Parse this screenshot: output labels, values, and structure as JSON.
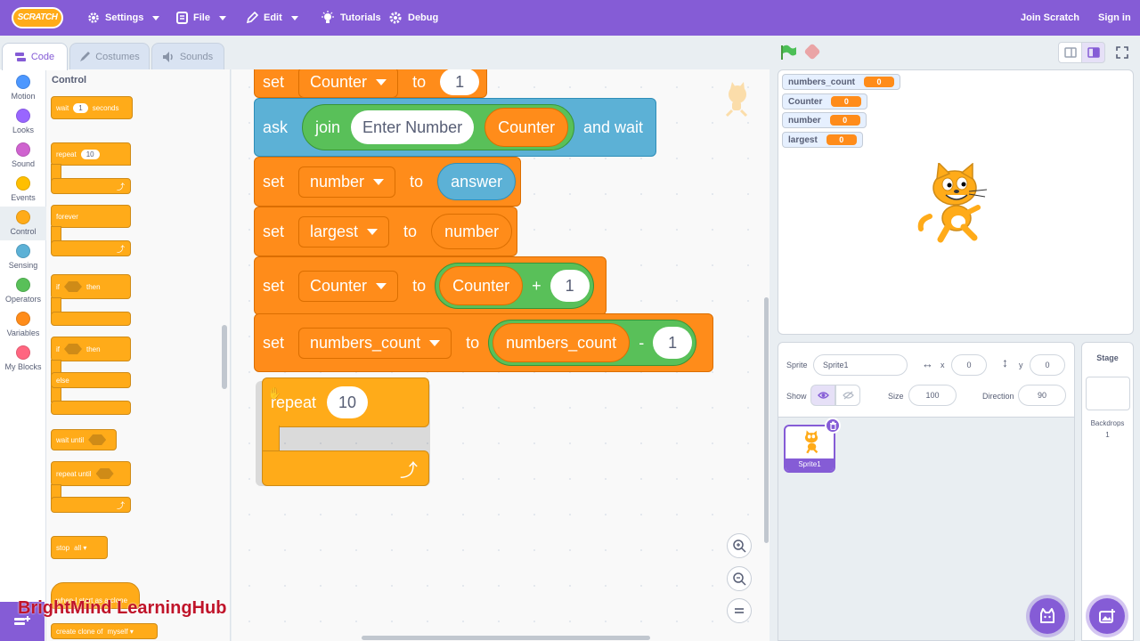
{
  "menubar": {
    "logo": "SCRATCH",
    "settings": "Settings",
    "file": "File",
    "edit": "Edit",
    "tutorials": "Tutorials",
    "debug": "Debug",
    "join": "Join Scratch",
    "signin": "Sign in",
    "color": "#855cd6"
  },
  "tabs": {
    "code": "Code",
    "costumes": "Costumes",
    "sounds": "Sounds"
  },
  "categories": [
    {
      "label": "Motion",
      "color": "#4c97ff"
    },
    {
      "label": "Looks",
      "color": "#9966ff"
    },
    {
      "label": "Sound",
      "color": "#cf63cf"
    },
    {
      "label": "Events",
      "color": "#ffbf00"
    },
    {
      "label": "Control",
      "color": "#ffab19"
    },
    {
      "label": "Sensing",
      "color": "#5cb1d6"
    },
    {
      "label": "Operators",
      "color": "#59c059"
    },
    {
      "label": "Variables",
      "color": "#ff8c1a"
    },
    {
      "label": "My Blocks",
      "color": "#ff6680"
    }
  ],
  "palette": {
    "title": "Control",
    "wait": "wait",
    "wait_val": "1",
    "seconds": "seconds",
    "repeat": "repeat",
    "repeat_val": "10",
    "forever": "forever",
    "if": "if",
    "then": "then",
    "if2": "if",
    "then2": "then",
    "else": "else",
    "wait_until": "wait until",
    "repeat_until": "repeat until",
    "stop": "stop",
    "stop_val": "all",
    "when_clone": "when I start as a clone",
    "create_clone": "create clone of",
    "create_clone_val": "myself"
  },
  "script": {
    "set1": {
      "word": "set",
      "var": "Counter",
      "to": "to",
      "val": "1"
    },
    "ask": {
      "word": "ask",
      "join": "join",
      "text": "Enter Number",
      "var": "Counter",
      "wait": "and wait"
    },
    "set2": {
      "word": "set",
      "var": "number",
      "to": "to",
      "val": "answer"
    },
    "set3": {
      "word": "set",
      "var": "largest",
      "to": "to",
      "val": "number"
    },
    "set4": {
      "word": "set",
      "var": "Counter",
      "to": "to",
      "op_var": "Counter",
      "op": "+",
      "op_val": "1"
    },
    "set5": {
      "word": "set",
      "var": "numbers_count",
      "to": "to",
      "op_var": "numbers_count",
      "op": "-",
      "op_val": "1"
    },
    "repeat": {
      "word": "repeat",
      "val": "10"
    }
  },
  "watermark": "BrightMind LearningHub",
  "monitors": [
    {
      "name": "numbers_count",
      "value": "0"
    },
    {
      "name": "Counter",
      "value": "0"
    },
    {
      "name": "number",
      "value": "0"
    },
    {
      "name": "largest",
      "value": "0"
    }
  ],
  "sprite_info": {
    "sprite_label": "Sprite",
    "sprite_name": "Sprite1",
    "x_label": "x",
    "x_val": "0",
    "y_label": "y",
    "y_val": "0",
    "show_label": "Show",
    "size_label": "Size",
    "size_val": "100",
    "direction_label": "Direction",
    "direction_val": "90"
  },
  "sprites": [
    {
      "name": "Sprite1"
    }
  ],
  "stage_panel": {
    "title": "Stage",
    "backdrops_label": "Backdrops",
    "backdrops_count": "1"
  }
}
